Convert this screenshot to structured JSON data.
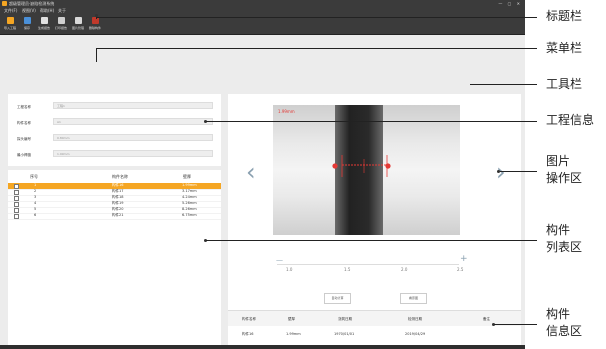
{
  "window": {
    "title": "超级管理员·缺陷检测系统"
  },
  "menu": [
    "文件(F)",
    "视图(V)",
    "帮助(H)",
    "关于"
  ],
  "toolbar": [
    "导入工程",
    "保存",
    "生成报告",
    "打印报告",
    "图片管理",
    "删除构件"
  ],
  "project_info": [
    {
      "label": "工程名称",
      "value": "工程1"
    },
    {
      "label": "构件名称",
      "value": "A1"
    },
    {
      "label": "探头编号",
      "value": "0.80mm"
    },
    {
      "label": "最小焊缝",
      "value": "1.99mm"
    }
  ],
  "component_table": {
    "headers": [
      "序号",
      "构件名称",
      "壁厚"
    ],
    "rows": [
      {
        "no": "1",
        "name": "构件16",
        "value": "1.99mm",
        "selected": true
      },
      {
        "no": "2",
        "name": "构件17",
        "value": "3.17mm",
        "selected": false
      },
      {
        "no": "3",
        "name": "构件18",
        "value": "4.24mm",
        "selected": false
      },
      {
        "no": "4",
        "name": "构件19",
        "value": "5.26mm",
        "selected": false
      },
      {
        "no": "5",
        "name": "构件20",
        "value": "8.26mm",
        "selected": false
      },
      {
        "no": "6",
        "name": "构件21",
        "value": "6.75mm",
        "selected": false
      }
    ]
  },
  "image": {
    "label": "1.99mm"
  },
  "zoom": {
    "ticks": [
      "1.0",
      "1.5",
      "2.0",
      "2.5"
    ],
    "minus": "—",
    "plus": "+"
  },
  "buttons": {
    "analyze": "自动计算",
    "view": "看原图"
  },
  "info_table": {
    "headers": [
      "构件名称",
      "壁厚",
      "浇筑日期",
      "检测日期",
      "备注"
    ],
    "row": [
      "构件16",
      "1.99mm",
      "1970/01/01",
      "2019/04/29",
      ""
    ]
  },
  "annotations": [
    "标题栏",
    "菜单栏",
    "工具栏",
    "工程信息",
    "图片",
    "操作区",
    "构件",
    "列表区",
    "构件",
    "信息区"
  ],
  "colors": {
    "accent": "#f5a623",
    "dark": "#3b3b3b",
    "marker": "#e53935"
  }
}
